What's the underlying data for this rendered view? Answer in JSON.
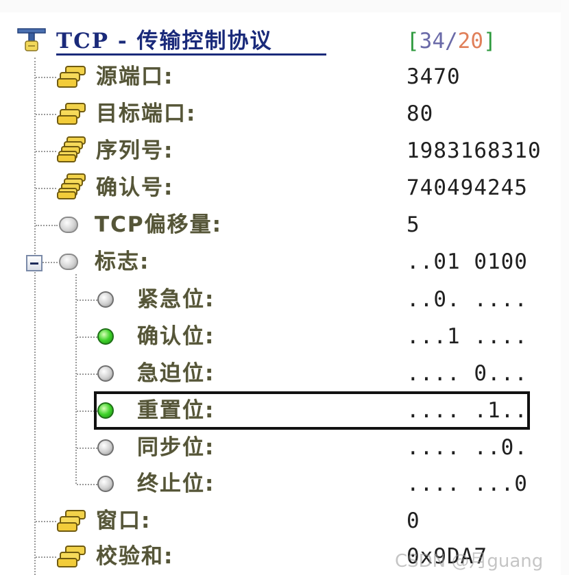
{
  "header": {
    "title": "TCP - 传输控制协议",
    "counter_open": "[",
    "counter_a": "34",
    "counter_sep": "/",
    "counter_b": "20",
    "counter_close": "]"
  },
  "fields": [
    {
      "label": "源端口:",
      "value": "3470",
      "icon": "coin-stack-icon"
    },
    {
      "label": "目标端口:",
      "value": "80",
      "icon": "coin-stack-icon"
    },
    {
      "label": "序列号:",
      "value": "1983168310",
      "icon": "tall-coin-stack-icon"
    },
    {
      "label": "确认号:",
      "value": "740494245",
      "icon": "tall-coin-stack-icon"
    },
    {
      "label": "TCP偏移量:",
      "value": "5",
      "icon": "gray-oval-icon"
    },
    {
      "label": "标志:",
      "value": "..01 0100",
      "icon": "gray-oval-icon"
    }
  ],
  "flags": [
    {
      "label": "紧急位:",
      "value": "..0. ....",
      "state": "off"
    },
    {
      "label": "确认位:",
      "value": "...1 ....",
      "state": "on"
    },
    {
      "label": "急迫位:",
      "value": ".... 0...",
      "state": "off"
    },
    {
      "label": "重置位:",
      "value": ".... .1..",
      "state": "on"
    },
    {
      "label": "同步位:",
      "value": ".... ..0.",
      "state": "off"
    },
    {
      "label": "终止位:",
      "value": ".... ...0",
      "state": "off"
    }
  ],
  "footer_fields": [
    {
      "label": "窗口:",
      "value": "0",
      "icon": "coin-stack-icon"
    },
    {
      "label": "校验和:",
      "value": "0x9DA7",
      "icon": "coin-stack-icon"
    }
  ],
  "watermark": "CSDN @月guang",
  "colors": {
    "title": "#1a2a7a",
    "label": "#555538",
    "counter_bracket": "#2e9a3e",
    "counter_a": "#6a6aa8",
    "counter_b": "#e0805a",
    "dot_on": "#3fd22a"
  }
}
